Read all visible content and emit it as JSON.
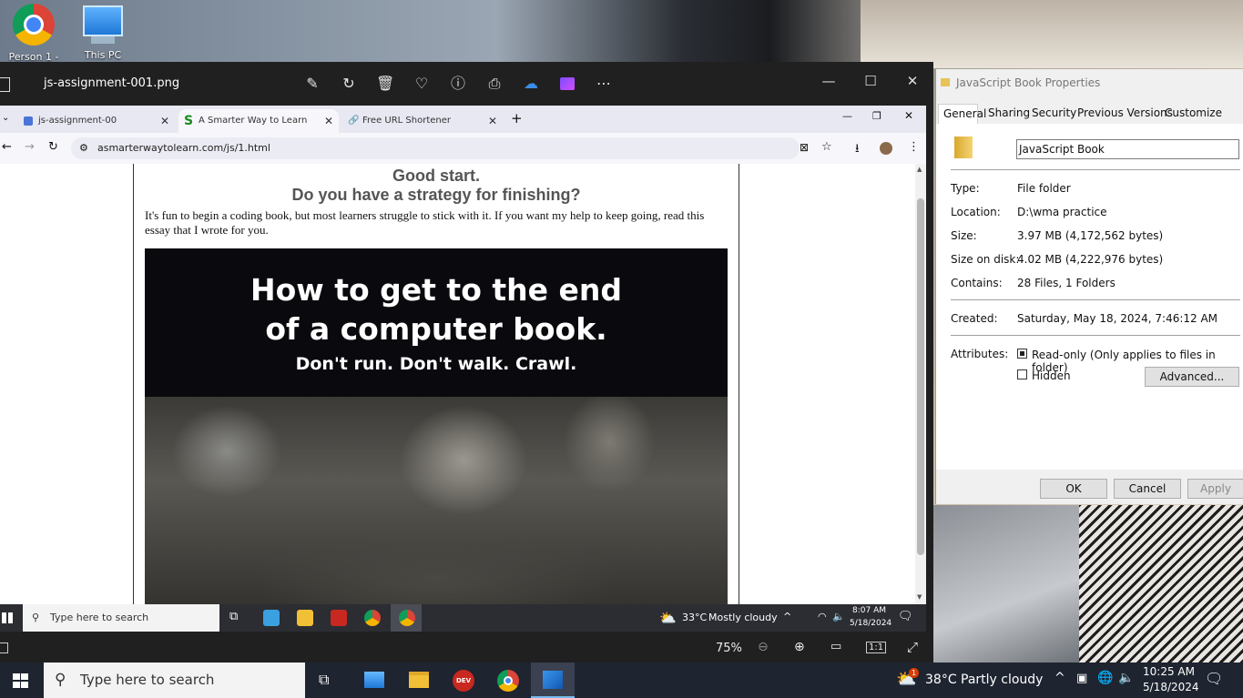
{
  "desktop": {
    "icons": [
      {
        "label": "Person 1 -"
      },
      {
        "label": "This PC"
      }
    ]
  },
  "photos": {
    "filename": "js-assignment-001.png",
    "zoom": "75%"
  },
  "browser": {
    "tabs": [
      {
        "label": "js-assignment-00"
      },
      {
        "label": "A Smarter Way to Learn JavaSc"
      },
      {
        "label": "Free URL Shortener"
      }
    ],
    "url": "asmarterwaytolearn.com/js/1.html",
    "page": {
      "heading1": "Good start.",
      "heading2": "Do you have a strategy for finishing?",
      "paragraph": "It's fun to begin a coding book, but most learners struggle to stick with it. If you want my help to keep going, read this essay that I wrote for you.",
      "banner_line1": "How to get to the end",
      "banner_line2": "of a computer book.",
      "banner_line3": "Don't run. Don't walk. Crawl."
    }
  },
  "inner_taskbar": {
    "search_placeholder": "Type here to search",
    "weather": "33°C",
    "weather_desc": "Mostly cloudy",
    "time": "8:07 AM",
    "date": "5/18/2024"
  },
  "properties": {
    "title": "JavaScript Book Properties",
    "tabs": [
      "General",
      "Sharing",
      "Security",
      "Previous Versions",
      "Customize"
    ],
    "name": "JavaScript Book",
    "type_label": "Type:",
    "type_value": "File folder",
    "location_label": "Location:",
    "location_value": "D:\\wma practice",
    "size_label": "Size:",
    "size_value": "3.97 MB (4,172,562 bytes)",
    "size_disk_label": "Size on disk:",
    "size_disk_value": "4.02 MB (4,222,976 bytes)",
    "contains_label": "Contains:",
    "contains_value": "28 Files, 1 Folders",
    "created_label": "Created:",
    "created_value": "Saturday, May 18, 2024, 7:46:12 AM",
    "attributes_label": "Attributes:",
    "readonly_label": "Read-only (Only applies to files in folder)",
    "hidden_label": "Hidden",
    "advanced_button": "Advanced...",
    "ok_button": "OK",
    "cancel_button": "Cancel",
    "apply_button": "Apply"
  },
  "taskbar": {
    "search_placeholder": "Type here to search",
    "weather": "38°C",
    "weather_desc": "Partly cloudy",
    "time": "10:25 AM",
    "date": "5/18/2024",
    "weather_badge": "1"
  }
}
